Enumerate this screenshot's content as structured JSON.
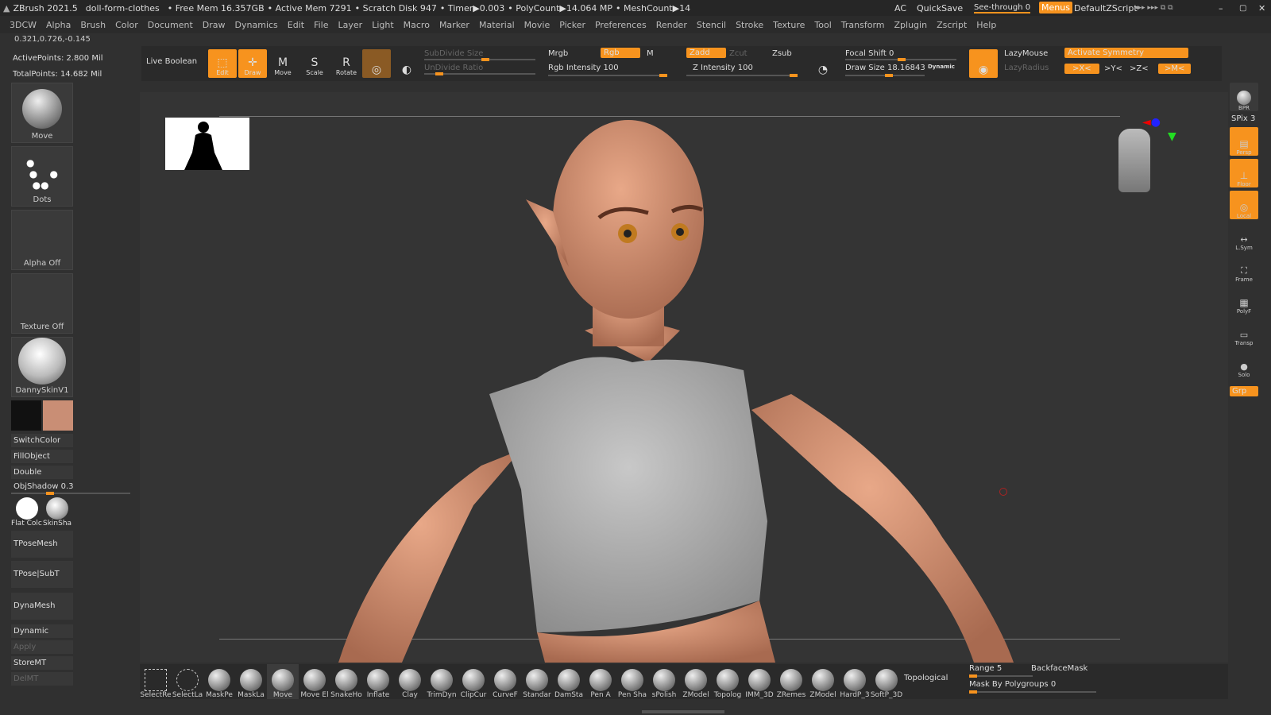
{
  "titlebar": {
    "app": "ZBrush 2021.5",
    "doc": "doll-form-clothes",
    "free_mem": "• Free Mem 16.357GB",
    "active_mem": "• Active Mem 7291",
    "scratch": "• Scratch Disk 947",
    "timer": "• Timer▶0.003",
    "poly": "• PolyCount▶14.064 MP",
    "mesh": "• MeshCount▶14",
    "ac": "AC",
    "quicksave": "QuickSave",
    "seethrough": "See-through  0",
    "menus": "Menus",
    "script": "DefaultZScript"
  },
  "menu": [
    "3DCW",
    "Alpha",
    "Brush",
    "Color",
    "Document",
    "Draw",
    "Dynamics",
    "Edit",
    "File",
    "Layer",
    "Light",
    "Macro",
    "Marker",
    "Material",
    "Movie",
    "Picker",
    "Preferences",
    "Render",
    "Stencil",
    "Stroke",
    "Texture",
    "Tool",
    "Transform",
    "Zplugin",
    "Zscript",
    "Help"
  ],
  "coords": "0.321,0.726,-0.145",
  "active_points": "ActivePoints: 2.800 Mil",
  "total_points": "TotalPoints: 14.682 Mil",
  "toolbar": {
    "live_boolean": "Live Boolean",
    "edit": "Edit",
    "draw": "Draw",
    "move": "Move",
    "scale": "Scale",
    "rotate": "Rotate",
    "subdivide": "SubDivide Size",
    "undivide": "UnDivide Ratio",
    "mrgb": "Mrgb",
    "rgb": "Rgb",
    "m": "M",
    "rgb_int": "Rgb Intensity 100",
    "zadd": "Zadd",
    "zcut": "Zcut",
    "zsub": "Zsub",
    "z_int": "Z Intensity 100",
    "focal": "Focal Shift 0",
    "draw_size": "Draw Size 18.16843",
    "dynamic": "Dynamic",
    "lazymouse": "LazyMouse",
    "lazyradius": "LazyRadius",
    "sym": "Activate Symmetry",
    "x": ">X<",
    "y": ">Y<",
    "z": ">Z<",
    "m2": ">M<"
  },
  "left": {
    "move": "Move",
    "dots": "Dots",
    "alpha": "Alpha Off",
    "texture": "Texture Off",
    "material": "DannySkinV1",
    "switchcolor": "SwitchColor",
    "fillobject": "FillObject",
    "double": "Double",
    "objshadow": "ObjShadow 0.3",
    "flat": "Flat Colc",
    "skin": "SkinSha",
    "tpose": "TPoseMesh",
    "tposesub": "TPose|SubT",
    "dynamesh": "DynaMesh",
    "dynamic": "Dynamic",
    "apply": "Apply",
    "storemt": "StoreMT",
    "delmt": "DelMT",
    "primary": "#111111",
    "secondary": "#c98e75"
  },
  "right": {
    "bpr": "BPR",
    "spix": "SPix 3",
    "persp": "Persp",
    "floor": "Floor",
    "local": "Local",
    "lsym": "L.Sym",
    "frame": "Frame",
    "polyf": "PolyF",
    "transp": "Transp",
    "solo": "Solo",
    "grp": "Grp"
  },
  "bottom": {
    "brushes": [
      "SelectRe",
      "SelectLa",
      "MaskPe",
      "MaskLa",
      "Move",
      "Move El",
      "SnakeHo",
      "Inflate",
      "Clay",
      "TrimDyn",
      "ClipCur",
      "CurveF",
      "Standar",
      "DamSta",
      "Pen A",
      "Pen Sha",
      "sPolish",
      "ZModel",
      "Topolog",
      "IMM_3D",
      "ZRemes",
      "ZModel",
      "HardP_3",
      "SoftP_3D"
    ],
    "topological": "Topological",
    "range": "Range 5",
    "backface": "BackfaceMask",
    "mask_poly": "Mask By Polygroups 0"
  }
}
